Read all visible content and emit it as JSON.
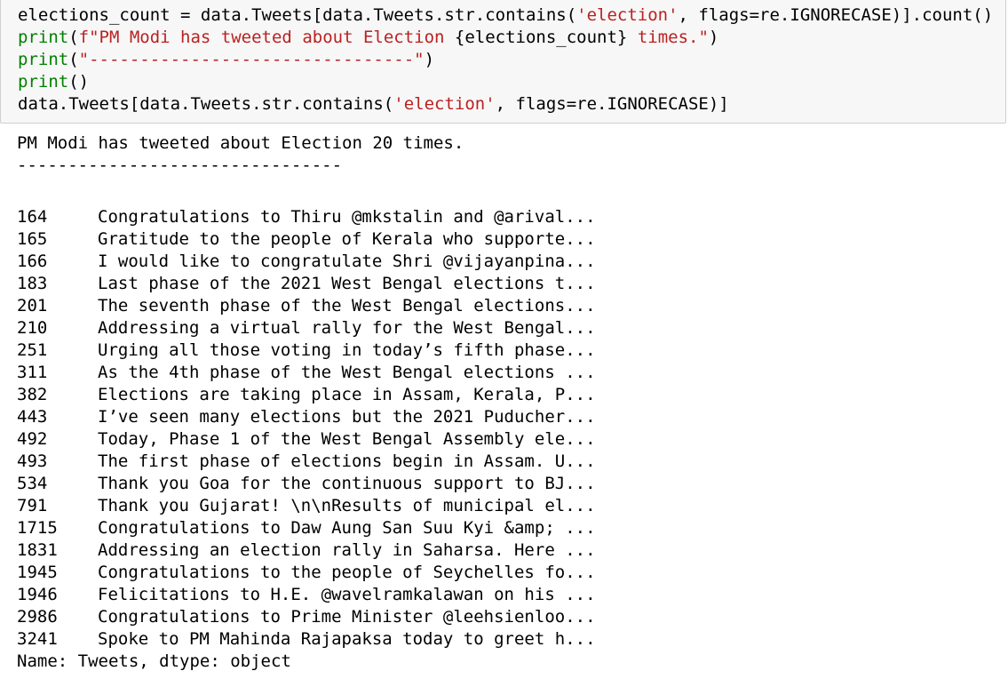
{
  "input": {
    "line1": {
      "a": "elections_count = data.Tweets[data.Tweets.str.contains(",
      "b": "'election'",
      "c": ", flags=re.IGNORECASE)].count()"
    },
    "line2": {
      "a": "print",
      "b": "(",
      "c": "f\"PM Modi has tweeted about Election ",
      "d": "{elections_count}",
      "e": " times.\"",
      "f": ")"
    },
    "line3": {
      "a": "print",
      "b": "(",
      "c": "\"--------------------------------\"",
      "d": ")"
    },
    "line4": {
      "a": "print",
      "b": "()"
    },
    "line5": {
      "a": "data.Tweets[data.Tweets.str.contains(",
      "b": "'election'",
      "c": ", flags=re.IGNORECASE)]"
    }
  },
  "output": {
    "message": "PM Modi has tweeted about Election 20 times.",
    "separator": "--------------------------------",
    "rows": [
      {
        "index": "164",
        "text": "Congratulations to Thiru @mkstalin and @arival..."
      },
      {
        "index": "165",
        "text": "Gratitude to the people of Kerala who supporte..."
      },
      {
        "index": "166",
        "text": "I would like to congratulate Shri @vijayanpina..."
      },
      {
        "index": "183",
        "text": "Last phase of the 2021 West Bengal elections t..."
      },
      {
        "index": "201",
        "text": "The seventh phase of the West Bengal elections..."
      },
      {
        "index": "210",
        "text": "Addressing a virtual rally for the West Bengal..."
      },
      {
        "index": "251",
        "text": "Urging all those voting in today’s fifth phase..."
      },
      {
        "index": "311",
        "text": "As the 4th phase of the West Bengal elections ..."
      },
      {
        "index": "382",
        "text": "Elections are taking place in Assam, Kerala, P..."
      },
      {
        "index": "443",
        "text": "I’ve seen many elections but the 2021 Puducher..."
      },
      {
        "index": "492",
        "text": "Today, Phase 1 of the West Bengal Assembly ele..."
      },
      {
        "index": "493",
        "text": "The first phase of elections begin in Assam. U..."
      },
      {
        "index": "534",
        "text": "Thank you Goa for the continuous support to BJ..."
      },
      {
        "index": "791",
        "text": "Thank you Gujarat! \\n\\nResults of municipal el..."
      },
      {
        "index": "1715",
        "text": "Congratulations to Daw Aung San Suu Kyi &amp; ..."
      },
      {
        "index": "1831",
        "text": "Addressing an election rally in Saharsa. Here ..."
      },
      {
        "index": "1945",
        "text": "Congratulations to the people of Seychelles fo..."
      },
      {
        "index": "1946",
        "text": "Felicitations to H.E. @wavelramkalawan on his ..."
      },
      {
        "index": "2986",
        "text": "Congratulations to Prime Minister @leehsienloo..."
      },
      {
        "index": "3241",
        "text": "Spoke to PM Mahinda Rajapaksa today to greet h..."
      }
    ],
    "footer": "Name: Tweets, dtype: object"
  },
  "colors": {
    "keyword": "#008000",
    "string": "#ba2121",
    "input_background": "#f7f7f7",
    "input_border": "#cfcfcf"
  }
}
